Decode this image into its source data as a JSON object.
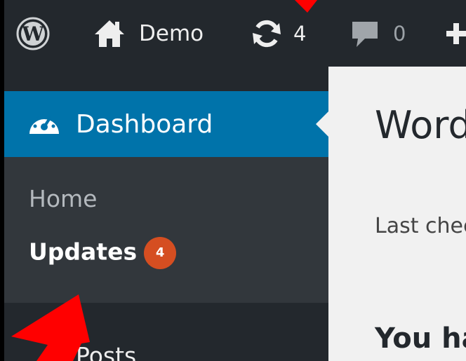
{
  "admin_bar": {
    "site_name": "Demo",
    "updates_count": "4",
    "comments_count": "0"
  },
  "sidebar": {
    "dashboard_label": "Dashboard",
    "submenu": [
      {
        "label": "Home"
      },
      {
        "label": "Updates",
        "badge": "4"
      }
    ],
    "posts_label": "Posts"
  },
  "content": {
    "title": "WordPress Updates",
    "last_checked": "Last checked on",
    "you_have": "You have"
  },
  "colors": {
    "admin_bar_bg": "#23282d",
    "dashboard_active": "#0073aa",
    "update_badge": "#d54e21",
    "annotation_arrow": "#ff0000"
  },
  "icons": [
    "wordpress-logo-icon",
    "home-icon",
    "updates-icon",
    "comments-icon",
    "new-content-icon",
    "dashboard-gauge-icon"
  ]
}
